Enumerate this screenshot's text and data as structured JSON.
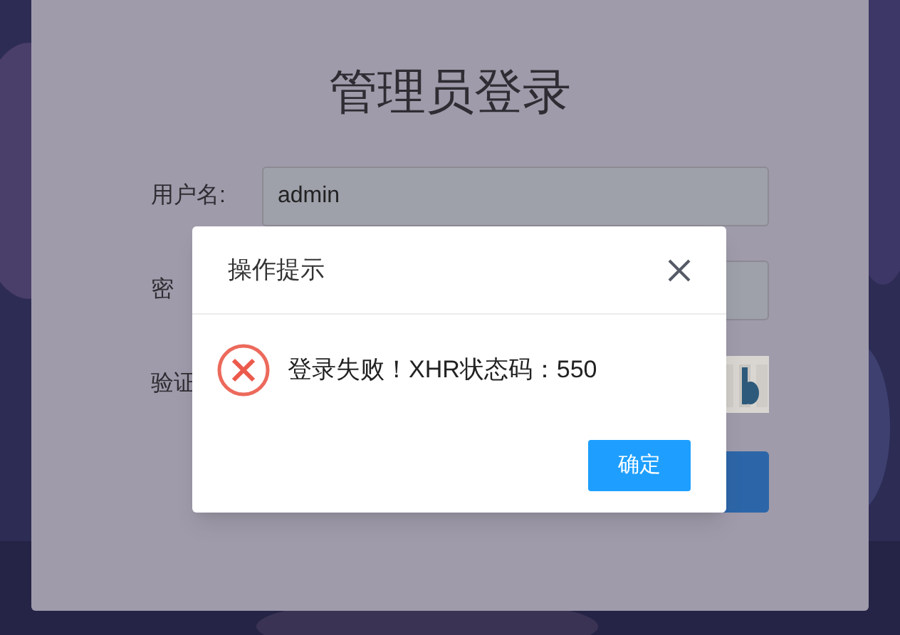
{
  "login_form": {
    "title": "管理员登录",
    "fields": [
      {
        "label": "用户名:",
        "value": "admin"
      },
      {
        "label": "密"
      },
      {
        "label": "验证",
        "kind": "captcha"
      }
    ]
  },
  "dialog": {
    "title": "操作提示",
    "message": "登录失败！XHR状态码：550",
    "confirm_button": "确定"
  }
}
